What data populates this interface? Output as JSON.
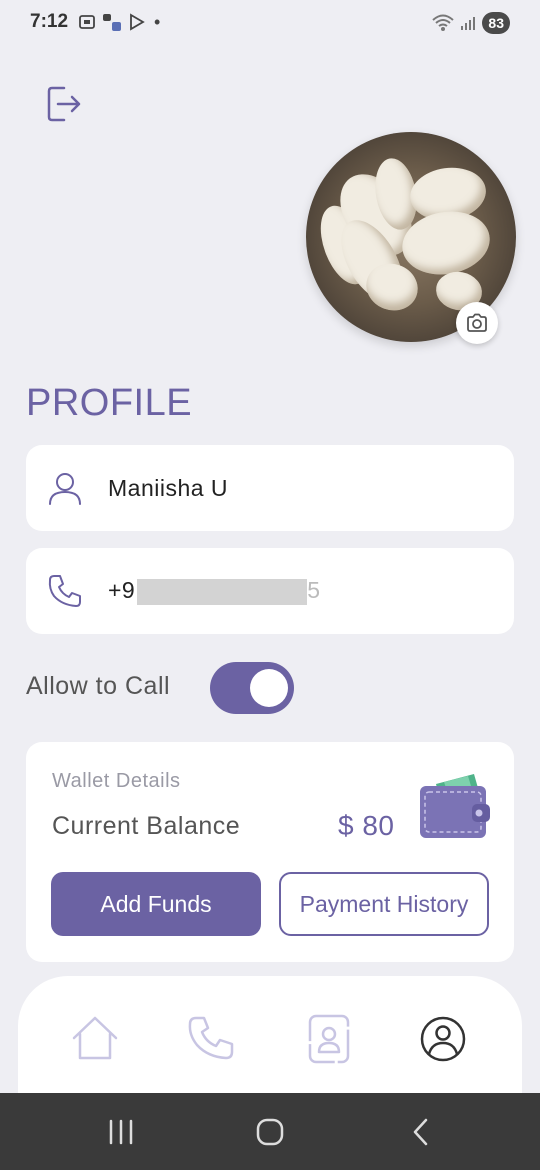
{
  "status_bar": {
    "time": "7:12",
    "battery": "83",
    "dot": "•"
  },
  "profile": {
    "title": "PROFILE",
    "name": "Maniisha U",
    "phone_prefix": "+9",
    "phone_suffix": "5"
  },
  "settings": {
    "allow_call_label": "Allow to Call",
    "allow_call_enabled": true
  },
  "wallet": {
    "title": "Wallet Details",
    "balance_label": "Current Balance",
    "balance_value": "$ 80",
    "add_funds_label": "Add Funds",
    "payment_history_label": "Payment History"
  },
  "nav": {
    "items": [
      "home-icon",
      "phone-icon",
      "contacts-icon",
      "profile-icon"
    ],
    "active": "profile-icon"
  },
  "colors": {
    "accent": "#6b62a3",
    "background": "#eeeef3",
    "card": "#ffffff"
  }
}
